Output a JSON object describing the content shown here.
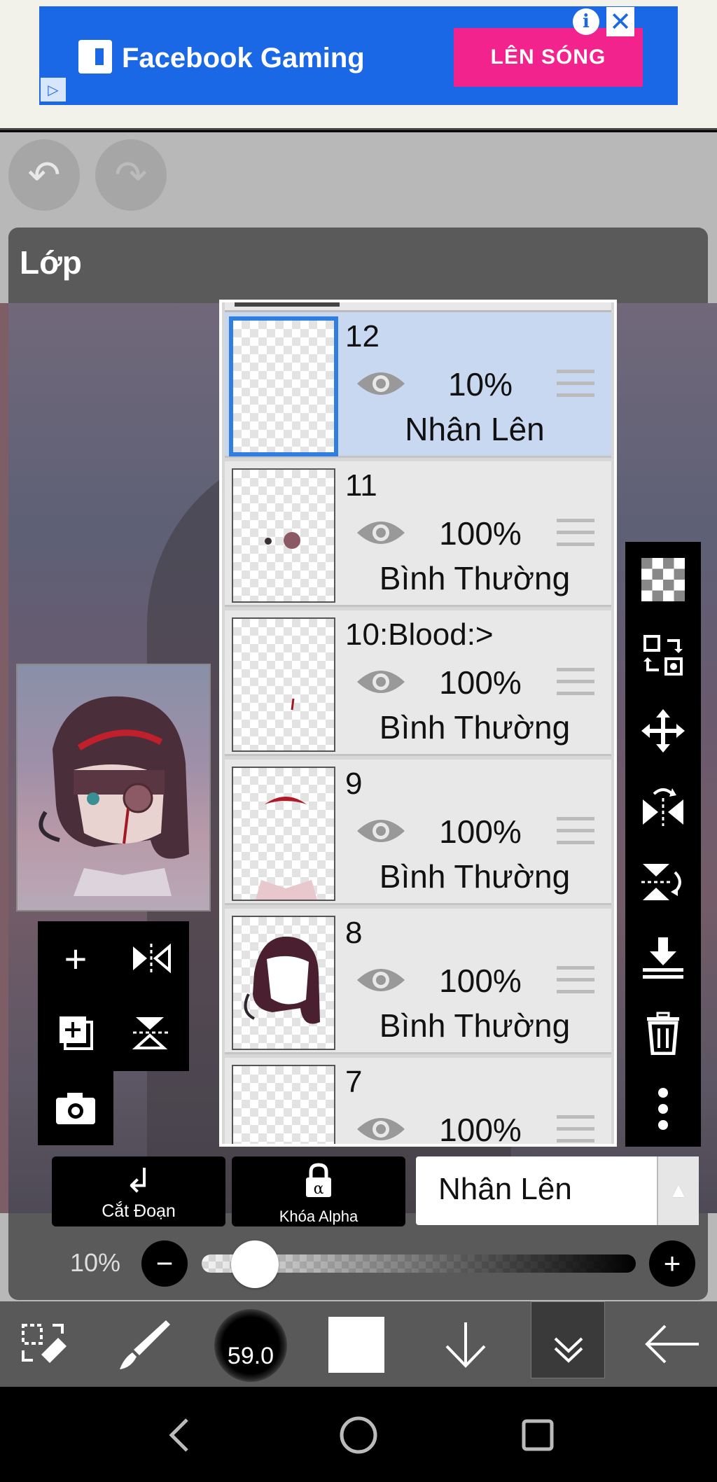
{
  "ad": {
    "title": "Facebook Gaming",
    "cta": "LÊN SÓNG",
    "info_icon": "i",
    "close_icon": "✕"
  },
  "toolbar_top": {
    "undo_icon": "↶",
    "redo_icon": "↷"
  },
  "panel": {
    "title": "Lớp"
  },
  "layers": [
    {
      "name": "12",
      "opacity": "10%",
      "mode": "Nhân Lên",
      "selected": true
    },
    {
      "name": "11",
      "opacity": "100%",
      "mode": "Bình Thường",
      "selected": false
    },
    {
      "name": "10:Blood:>",
      "opacity": "100%",
      "mode": "Bình Thường",
      "selected": false
    },
    {
      "name": "9",
      "opacity": "100%",
      "mode": "Bình Thường",
      "selected": false
    },
    {
      "name": "8",
      "opacity": "100%",
      "mode": "Bình Thường",
      "selected": false
    },
    {
      "name": "7",
      "opacity": "100%",
      "mode": "",
      "selected": false
    }
  ],
  "mini_tools": {
    "add_icon": "+",
    "add_copy_icon": "+",
    "flip_h_icon": "flip-horizontal-icon",
    "flip_v_icon": "flip-vertical-icon",
    "camera_icon": "camera-icon"
  },
  "right_tools": [
    "transparency-icon",
    "layer-transform-icon",
    "move-icon",
    "flip-horizontal-icon",
    "flip-vertical-icon",
    "merge-down-icon",
    "delete-icon",
    "more-icon"
  ],
  "controls": {
    "clip_label": "Cắt Đoạn",
    "alpha_label": "Khóa Alpha",
    "alpha_symbol": "α",
    "blend_mode": "Nhân Lên",
    "opacity_label": "10%",
    "opacity_value": 0.1
  },
  "bottom_bar": {
    "brush_size": "59.0"
  },
  "colors": {
    "selected_layer_bg": "#c8d8f0",
    "selected_border": "#2f7ee0",
    "ad_blue": "#1a68e6",
    "ad_pink": "#f2238c"
  }
}
